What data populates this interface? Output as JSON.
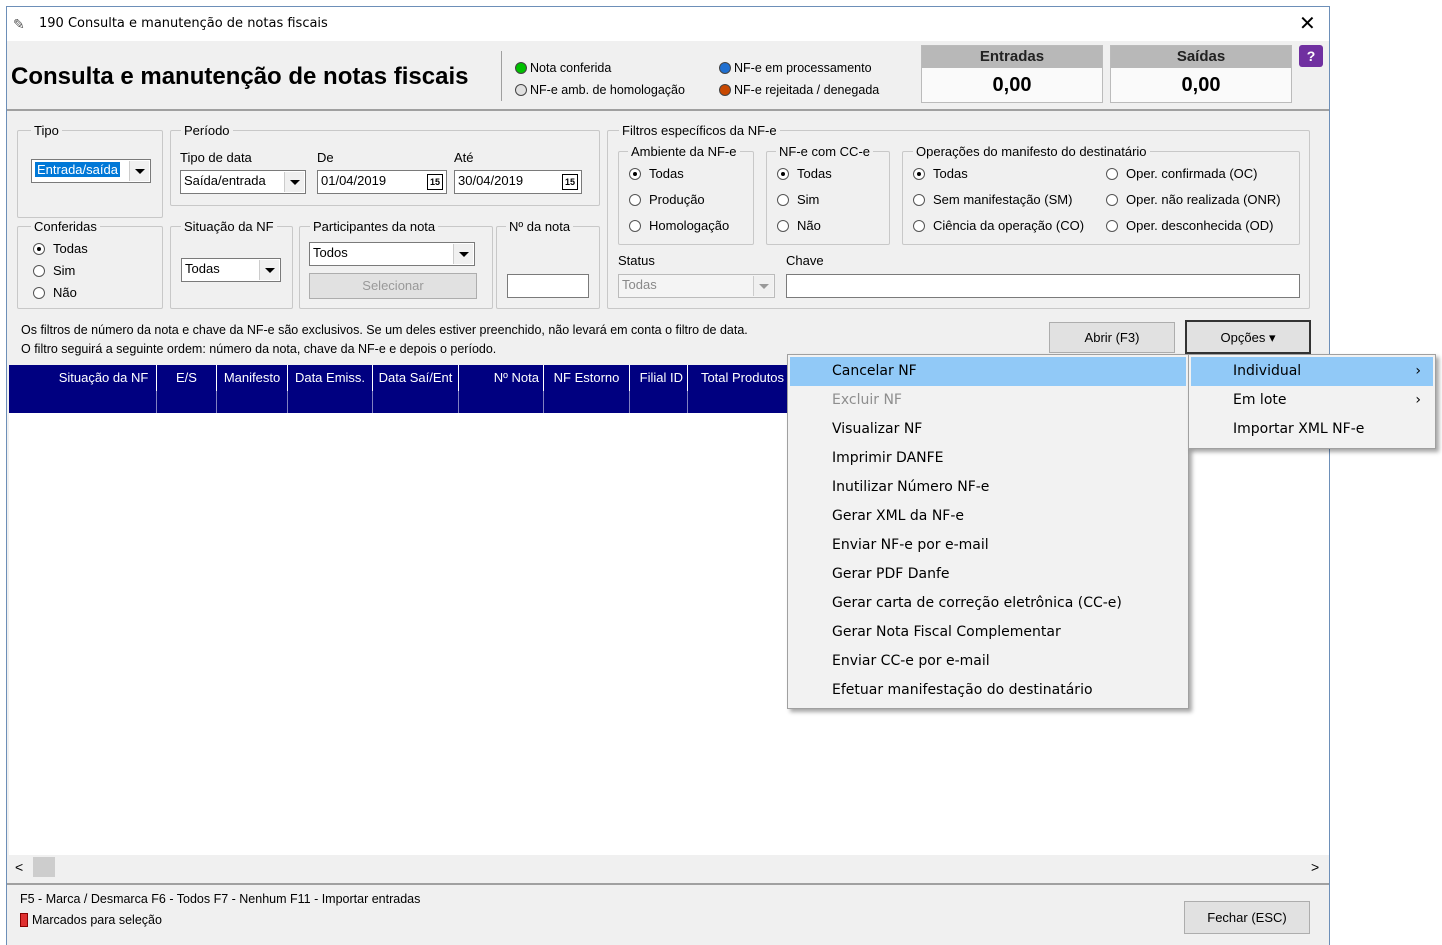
{
  "window": {
    "title": "190 Consulta e manutenção de notas fiscais",
    "close": "✕"
  },
  "header": {
    "title": "Consulta e manutenção de notas fiscais",
    "legend": [
      {
        "label": "Nota conferida",
        "color": "#00c000"
      },
      {
        "label": "NF-e amb. de homologação",
        "color": "#e0e0e0"
      },
      {
        "label": "NF-e em processamento",
        "color": "#1f6fd0"
      },
      {
        "label": "NF-e rejeitada / denegada",
        "color": "#c84800"
      }
    ],
    "entradas": {
      "label": "Entradas",
      "value": "0,00"
    },
    "saidas": {
      "label": "Saídas",
      "value": "0,00"
    },
    "help": "?"
  },
  "tipo": {
    "title": "Tipo",
    "value": "Entrada/saída"
  },
  "periodo": {
    "title": "Período",
    "tipo_data_label": "Tipo de data",
    "tipo_data_value": "Saída/entrada",
    "de_label": "De",
    "de_value": "01/04/2019",
    "ate_label": "Até",
    "ate_value": "30/04/2019",
    "cal": "15"
  },
  "conferidas": {
    "title": "Conferidas",
    "options": [
      "Todas",
      "Sim",
      "Não"
    ]
  },
  "situacao": {
    "title": "Situação da NF",
    "value": "Todas"
  },
  "participantes": {
    "title": "Participantes da nota",
    "value": "Todos",
    "button": "Selecionar"
  },
  "nota": {
    "title": "Nº da nota",
    "value": ""
  },
  "filtros": {
    "title": "Filtros específicos da NF-e",
    "ambiente": {
      "title": "Ambiente da NF-e",
      "options": [
        "Todas",
        "Produção",
        "Homologação"
      ]
    },
    "cce": {
      "title": "NF-e com CC-e",
      "options": [
        "Todas",
        "Sim",
        "Não"
      ]
    },
    "manifesto": {
      "title": "Operações do manifesto do destinatário",
      "options": [
        "Todas",
        "Sem manifestação (SM)",
        "Ciência da operação (CO)",
        "Oper. confirmada (OC)",
        "Oper. não realizada (ONR)",
        "Oper. desconhecida (OD)"
      ]
    },
    "status_label": "Status",
    "status_value": "Todas",
    "chave_label": "Chave",
    "chave_value": ""
  },
  "info": {
    "line1": "Os filtros de número da nota e chave da NF-e são exclusivos. Se um deles estiver preenchido, não levará em conta o filtro de data.",
    "line2": "O filtro seguirá a seguinte ordem: número da nota, chave da NF-e e depois o período."
  },
  "buttons": {
    "abrir": "Abrir (F3)",
    "opcoes": "Opções",
    "fechar": "Fechar (ESC)"
  },
  "grid": {
    "columns": [
      "Situação da NF",
      "E/S",
      "Manifesto",
      "Data Emiss.",
      "Data Saí/Ent",
      "Nº Nota",
      "NF Estorno",
      "Filial ID",
      "Total Produtos"
    ]
  },
  "menu": {
    "items": [
      {
        "label": "Cancelar NF",
        "state": "highlighted"
      },
      {
        "label": "Excluir NF",
        "state": "disabled"
      },
      {
        "label": "Visualizar NF",
        "state": "normal"
      },
      {
        "label": "Imprimir DANFE",
        "state": "normal"
      },
      {
        "label": "Inutilizar Número NF-e",
        "state": "normal"
      },
      {
        "label": "Gerar XML da NF-e",
        "state": "normal"
      },
      {
        "label": "Enviar NF-e por e-mail",
        "state": "normal"
      },
      {
        "label": "Gerar PDF Danfe",
        "state": "normal"
      },
      {
        "label": "Gerar carta de correção eletrônica (CC-e)",
        "state": "normal"
      },
      {
        "label": "Gerar Nota Fiscal Complementar",
        "state": "normal"
      },
      {
        "label": "Enviar CC-e por e-mail",
        "state": "normal"
      },
      {
        "label": "Efetuar manifestação do destinatário",
        "state": "normal"
      }
    ],
    "submenu": [
      {
        "label": "Individual",
        "state": "highlighted"
      },
      {
        "label": "Em lote",
        "state": "normal"
      },
      {
        "label": "Importar XML NF-e",
        "state": "normal"
      }
    ]
  },
  "footer": {
    "shortcuts": "F5 - Marca / Desmarca   F6 - Todos   F7 - Nenhum   F11 - Importar entradas",
    "marked": "Marcados para seleção",
    "marked_color": "#e03030"
  },
  "scroll": {
    "left": "<",
    "right": ">"
  }
}
